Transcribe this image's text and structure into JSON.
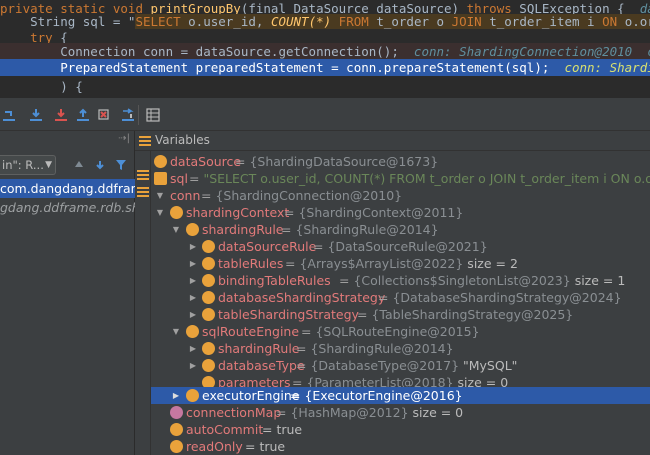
{
  "editor": {
    "line1": {
      "kw1": "private static void ",
      "method": "printGroupBy",
      "params": "(final DataSource dataSource) ",
      "kw2": "throws",
      "rest": " SQLException {  ",
      "inline": "dataSo"
    },
    "line2": {
      "prefix": "    String sql = \"",
      "sql1": "SELECT",
      "sql2": " o.user_id, ",
      "sql3": "COUNT(*)",
      "sql4": " FROM",
      "sql5": " t_order o ",
      "sql6": "JOIN",
      "sql7": " t_order_item i ",
      "sql8": "ON",
      "sql9": " o.order_"
    },
    "line3": {
      "kw": "    try",
      "rest": " {"
    },
    "line4": {
      "code": "        Connection conn = dataSource.getConnection();  ",
      "inline": "conn: ShardingConnection@2010  c"
    },
    "line5": {
      "code": "        PreparedStatement preparedStatement = conn.prepareStatement(sql);  ",
      "inline": "conn: Shardin"
    },
    "line6": {
      "code": "        ) {"
    }
  },
  "toolbar": {
    "buttons": [
      "step-over-icon",
      "step-into-icon",
      "force-step-into-icon",
      "step-out-icon",
      "drop-frame-icon",
      "run-to-cursor-icon",
      "evaluate-expression-icon"
    ]
  },
  "frames": {
    "thread_label": "in\": R...",
    "rows": [
      {
        "text": "com.dangdang.ddframe"
      },
      {
        "text": "gdang.ddframe.rdb.sha"
      }
    ]
  },
  "variables": {
    "title": "Variables",
    "rows": [
      {
        "name": "dataSource",
        "sep": " = ",
        "value": "{ShardingDataSource@1673}",
        "extra": ""
      },
      {
        "name": "sql",
        "sep": " = ",
        "value": "\"SELECT o.user_id, COUNT(*) FROM t_order o JOIN t_order_item i ON o.orde",
        "extra": ""
      },
      {
        "name": "conn",
        "sep": " = ",
        "value": "{ShardingConnection@2010}",
        "extra": ""
      },
      {
        "name": "shardingContext",
        "sep": " = ",
        "value": "{ShardingContext@2011}",
        "extra": ""
      },
      {
        "name": "shardingRule",
        "sep": " = ",
        "value": "{ShardingRule@2014}",
        "extra": ""
      },
      {
        "name": "dataSourceRule",
        "sep": " = ",
        "value": "{DataSourceRule@2021}",
        "extra": ""
      },
      {
        "name": "tableRules",
        "sep": " = ",
        "value": "{Arrays$ArrayList@2022}",
        "extra": "  size = 2"
      },
      {
        "name": "bindingTableRules",
        "sep": " = ",
        "value": "{Collections$SingletonList@2023}",
        "extra": "  size = 1"
      },
      {
        "name": "databaseShardingStrategy",
        "sep": " = ",
        "value": "{DatabaseShardingStrategy@2024}",
        "extra": ""
      },
      {
        "name": "tableShardingStrategy",
        "sep": " = ",
        "value": "{TableShardingStrategy@2025}",
        "extra": ""
      },
      {
        "name": "sqlRouteEngine",
        "sep": " = ",
        "value": "{SQLRouteEngine@2015}",
        "extra": ""
      },
      {
        "name": "shardingRule",
        "sep": " = ",
        "value": "{ShardingRule@2014}",
        "extra": ""
      },
      {
        "name": "databaseType",
        "sep": " = ",
        "value": "{DatabaseType@2017}",
        "extra": " \"MySQL\""
      },
      {
        "name": "parameters",
        "sep": " = ",
        "value": "{ParameterList@2018}",
        "extra": "  size = 0"
      },
      {
        "name": "executorEngine",
        "sep": " = ",
        "value": "{ExecutorEngine@2016}",
        "extra": ""
      },
      {
        "name": "connectionMap",
        "sep": " = ",
        "value": "{HashMap@2012}",
        "extra": "  size = 0"
      },
      {
        "name": "autoCommit",
        "sep": " = ",
        "value": "true",
        "extra": ""
      },
      {
        "name": "readOnly",
        "sep": " = ",
        "value": "true",
        "extra": ""
      }
    ]
  },
  "colors": {
    "background": "#2b2b2b",
    "panel": "#3c3f41",
    "selection": "#2d5aa8",
    "field_name": "#e27a7a",
    "icon_orange": "#e9a23b",
    "icon_pink": "#c678a0"
  }
}
